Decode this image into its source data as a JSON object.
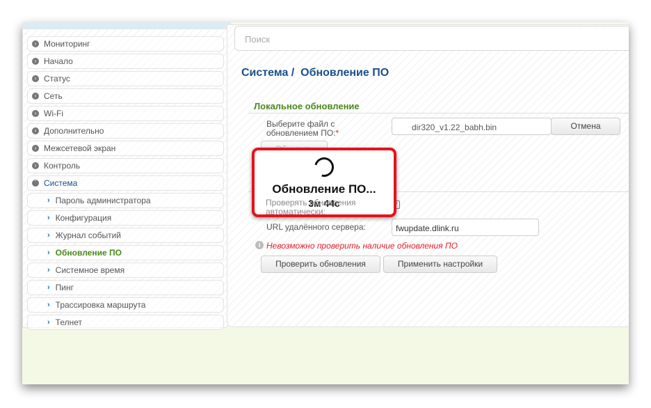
{
  "sidebar": {
    "items": [
      "Мониторинг",
      "Начало",
      "Статус",
      "Сеть",
      "Wi-Fi",
      "Дополнительно",
      "Межсетевой экран",
      "Контроль",
      "Система"
    ],
    "subitems": [
      "Пароль администратора",
      "Конфигурация",
      "Журнал событий",
      "Обновление ПО",
      "Системное время",
      "Пинг",
      "Трассировка маршрута",
      "Телнет"
    ]
  },
  "search": {
    "placeholder": "Поиск"
  },
  "breadcrumb": {
    "parent": "Система /",
    "current": "Обновление ПО"
  },
  "local": {
    "title": "Локальное обновление",
    "file_label": "Выберите файл с обновлением ПО:",
    "required": "*",
    "file_value": "dir320_v1.22_babh.bin",
    "cancel": "Отмена",
    "update": "Обновить"
  },
  "remote": {
    "title": "Удалённое обновление",
    "auto_label": "Проверять обновления автоматически:",
    "url_label": "URL удалённого сервера:",
    "url_value": "fwupdate.dlink.ru",
    "error": "Невозможно проверить наличие обновления ПО",
    "check": "Проверить обновления",
    "apply": "Применить настройки"
  },
  "modal": {
    "title": "Обновление ПО...",
    "time": "3м 44с"
  }
}
